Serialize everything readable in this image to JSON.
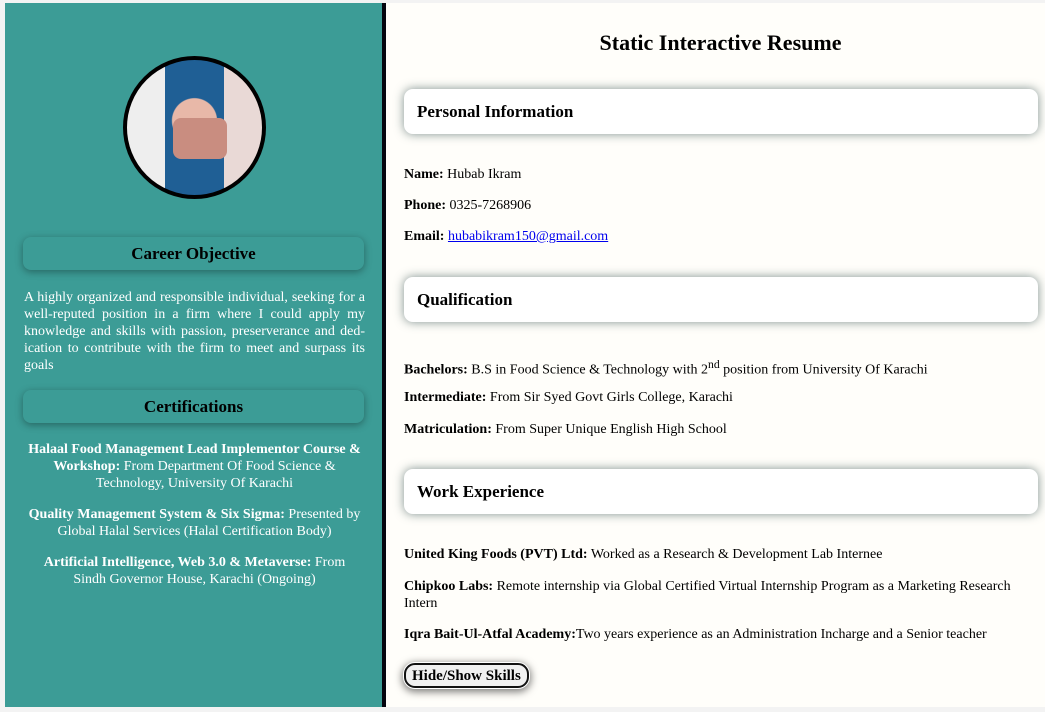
{
  "sidebar": {
    "career_heading": "Career Objective",
    "career_text": "A highly organized and responsible individual, seeking for a well-reputed position in a firm where I could apply my knowledge and skills with passion, preserverance and ded­ication to contribute with the firm to meet and surpass its goals",
    "cert_heading": "Certifications",
    "certs": [
      {
        "title": "Halaal Food Management Lead Implementor Course & Workshop:",
        "detail": " From Department Of Food Science & Technology, University Of Karachi"
      },
      {
        "title": "Quality Management System & Six Sigma:",
        "detail": " Presented by Global Halal Services (Halal Certification Body)"
      },
      {
        "title": "Artificial Intelligence, Web 3.0 & Metaverse:",
        "detail": " From Sindh Governor House, Karachi (Ongoing)"
      }
    ]
  },
  "main": {
    "title": "Static Interactive Resume",
    "personal_heading": "Personal Information",
    "name_label": "Name:",
    "name": " Hubab Ikram",
    "phone_label": "Phone:",
    "phone": " 0325-7268906",
    "email_label": "Email:",
    "email": "hubabikram150@gmail.com",
    "qual_heading": "Qualification",
    "quals": [
      {
        "label": "Bachelors:",
        "text": " B.S in Food Science & Technology with 2",
        "sup": "nd",
        "text2": " position from University Of Karachi"
      },
      {
        "label": "Intermediate:",
        "text": " From Sir Syed Govt Girls College, Karachi"
      },
      {
        "label": "Matriculation:",
        "text": " From Super Unique English High School"
      }
    ],
    "work_heading": "Work Experience",
    "work": [
      {
        "label": "United King Foods (PVT) Ltd:",
        "text": " Worked as a Research & Development Lab Internee"
      },
      {
        "label": "Chipkoo Labs:",
        "text": " Remote internship via Global Certified Virtual Internship Program as a Marketing Research Intern"
      },
      {
        "label": "Iqra Bait-Ul-Atfal Academy:",
        "text": "Two years experience as an Administration Incharge and a Senior teacher"
      }
    ],
    "skills_button": "Hide/Show Skills"
  },
  "colors": {
    "sidebar": "#3c9c96",
    "main": "#fffefa",
    "link": "#0000ee"
  }
}
